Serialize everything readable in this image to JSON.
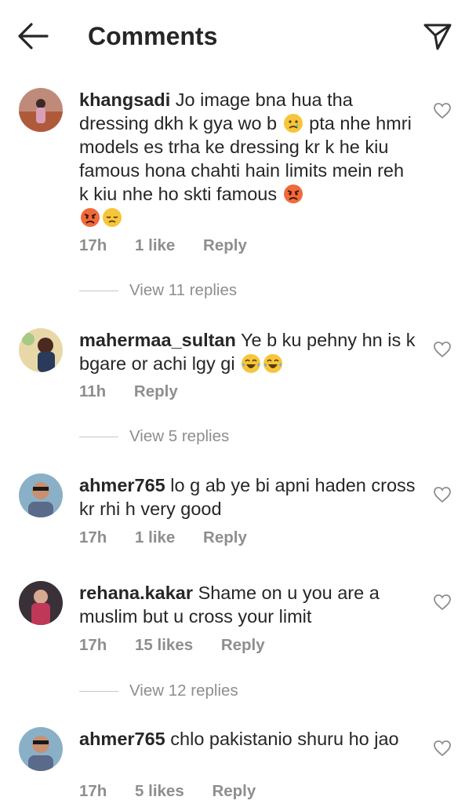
{
  "header": {
    "title": "Comments",
    "back_icon": "arrow-left-icon",
    "send_icon": "paper-plane-icon"
  },
  "comments": [
    {
      "username": "khangsadi",
      "text_parts": [
        "Jo image bna hua tha dressing dkh k  gya wo b ",
        " pta nhe hmri models es trha ke dressing kr  k he kiu famous hona chahti hain limits mein reh k kiu nhe ho skti famous "
      ],
      "emojis": [
        "sad-tear-emoji",
        "angry-emoji",
        "angry-emoji",
        "disappointed-emoji"
      ],
      "time": "17h",
      "likes": "1 like",
      "reply": "Reply",
      "view_replies": "View 11 replies"
    },
    {
      "username": "mahermaa_sultan",
      "text_parts": [
        "Ye b ku pehny hn is k bgare or achi lgy gi "
      ],
      "emojis": [
        "laughing-tears-emoji",
        "laughing-tears-emoji"
      ],
      "time": "11h",
      "likes": "",
      "reply": "Reply",
      "view_replies": "View 5 replies"
    },
    {
      "username": "ahmer765",
      "text_parts": [
        "lo g ab ye bi apni haden cross kr rhi h very good"
      ],
      "time": "17h",
      "likes": "1 like",
      "reply": "Reply"
    },
    {
      "username": "rehana.kakar",
      "text_parts": [
        "Shame on u you are a muslim but u cross your limit"
      ],
      "time": "17h",
      "likes": "15 likes",
      "reply": "Reply",
      "view_replies": "View 12 replies"
    },
    {
      "username": "ahmer765",
      "text_parts": [
        "chlo pakistanio shuru ho jao"
      ],
      "time": "17h",
      "likes": "5 likes",
      "reply": "Reply"
    }
  ],
  "colors": {
    "text": "#262626",
    "secondary": "#8e8e8e",
    "divider": "#c7c7c7",
    "background": "#ffffff"
  }
}
